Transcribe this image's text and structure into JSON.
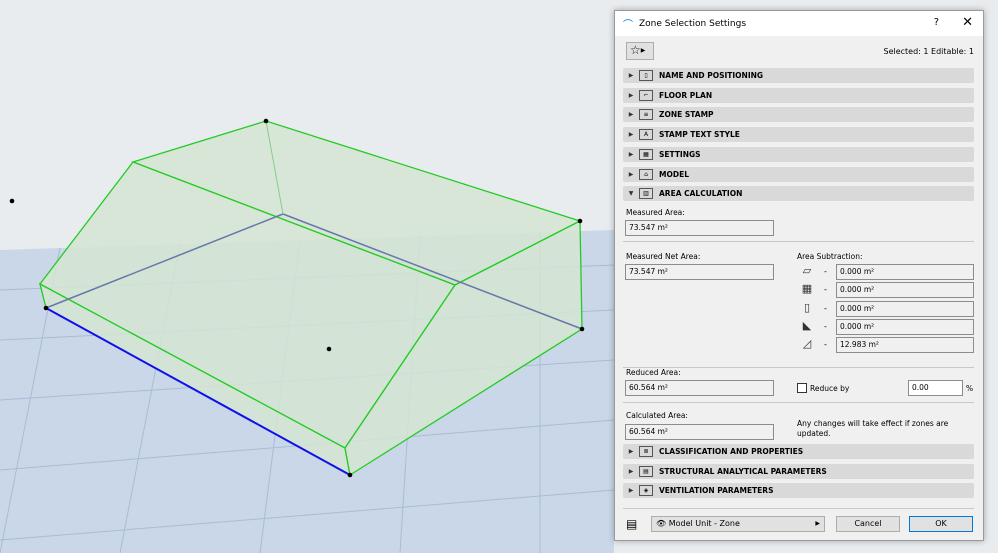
{
  "dialog": {
    "title": "Zone Selection Settings",
    "help": "?",
    "close": "✕",
    "selection_info": "Selected: 1 Editable: 1"
  },
  "sections_top": [
    {
      "label": "NAME AND POSITIONING",
      "icon": "▯"
    },
    {
      "label": "FLOOR PLAN",
      "icon": "⌐"
    },
    {
      "label": "ZONE STAMP",
      "icon": "≡"
    },
    {
      "label": "STAMP TEXT STYLE",
      "icon": "A"
    },
    {
      "label": "SETTINGS",
      "icon": "▦"
    },
    {
      "label": "MODEL",
      "icon": "⌂"
    },
    {
      "label": "AREA CALCULATION",
      "icon": "▥"
    }
  ],
  "area": {
    "measured_label": "Measured Area:",
    "measured_value": "73.547 m²",
    "net_label": "Measured Net Area:",
    "net_value": "73.547 m²",
    "subtraction_label": "Area Subtraction:",
    "subtractions": [
      {
        "icon": "▱",
        "value": "0.000 m²"
      },
      {
        "icon": "▦",
        "value": "0.000 m²"
      },
      {
        "icon": "▯",
        "value": "0.000 m²"
      },
      {
        "icon": "◣",
        "value": "0.000 m²"
      },
      {
        "icon": "◿",
        "value": "12.983 m²"
      }
    ],
    "dash": "-",
    "reduced_label": "Reduced Area:",
    "reduced_value": "60.564 m²",
    "reduce_by_label": "Reduce by",
    "reduce_by_value": "0.00",
    "percent": "%",
    "calculated_label": "Calculated Area:",
    "calculated_value": "60.564 m²",
    "note": "Any changes will take effect if zones are updated."
  },
  "sections_bottom": [
    {
      "label": "CLASSIFICATION AND PROPERTIES",
      "icon": "≣"
    },
    {
      "label": "STRUCTURAL ANALYTICAL PARAMETERS",
      "icon": "▤"
    },
    {
      "label": "VENTILATION PARAMETERS",
      "icon": "◈"
    }
  ],
  "footer": {
    "layer": "Model Unit - Zone",
    "cancel": "Cancel",
    "ok": "OK"
  },
  "colors": {
    "accent": "#0078d7",
    "edge_green": "#22cc22",
    "edge_blue": "#1010ee"
  }
}
